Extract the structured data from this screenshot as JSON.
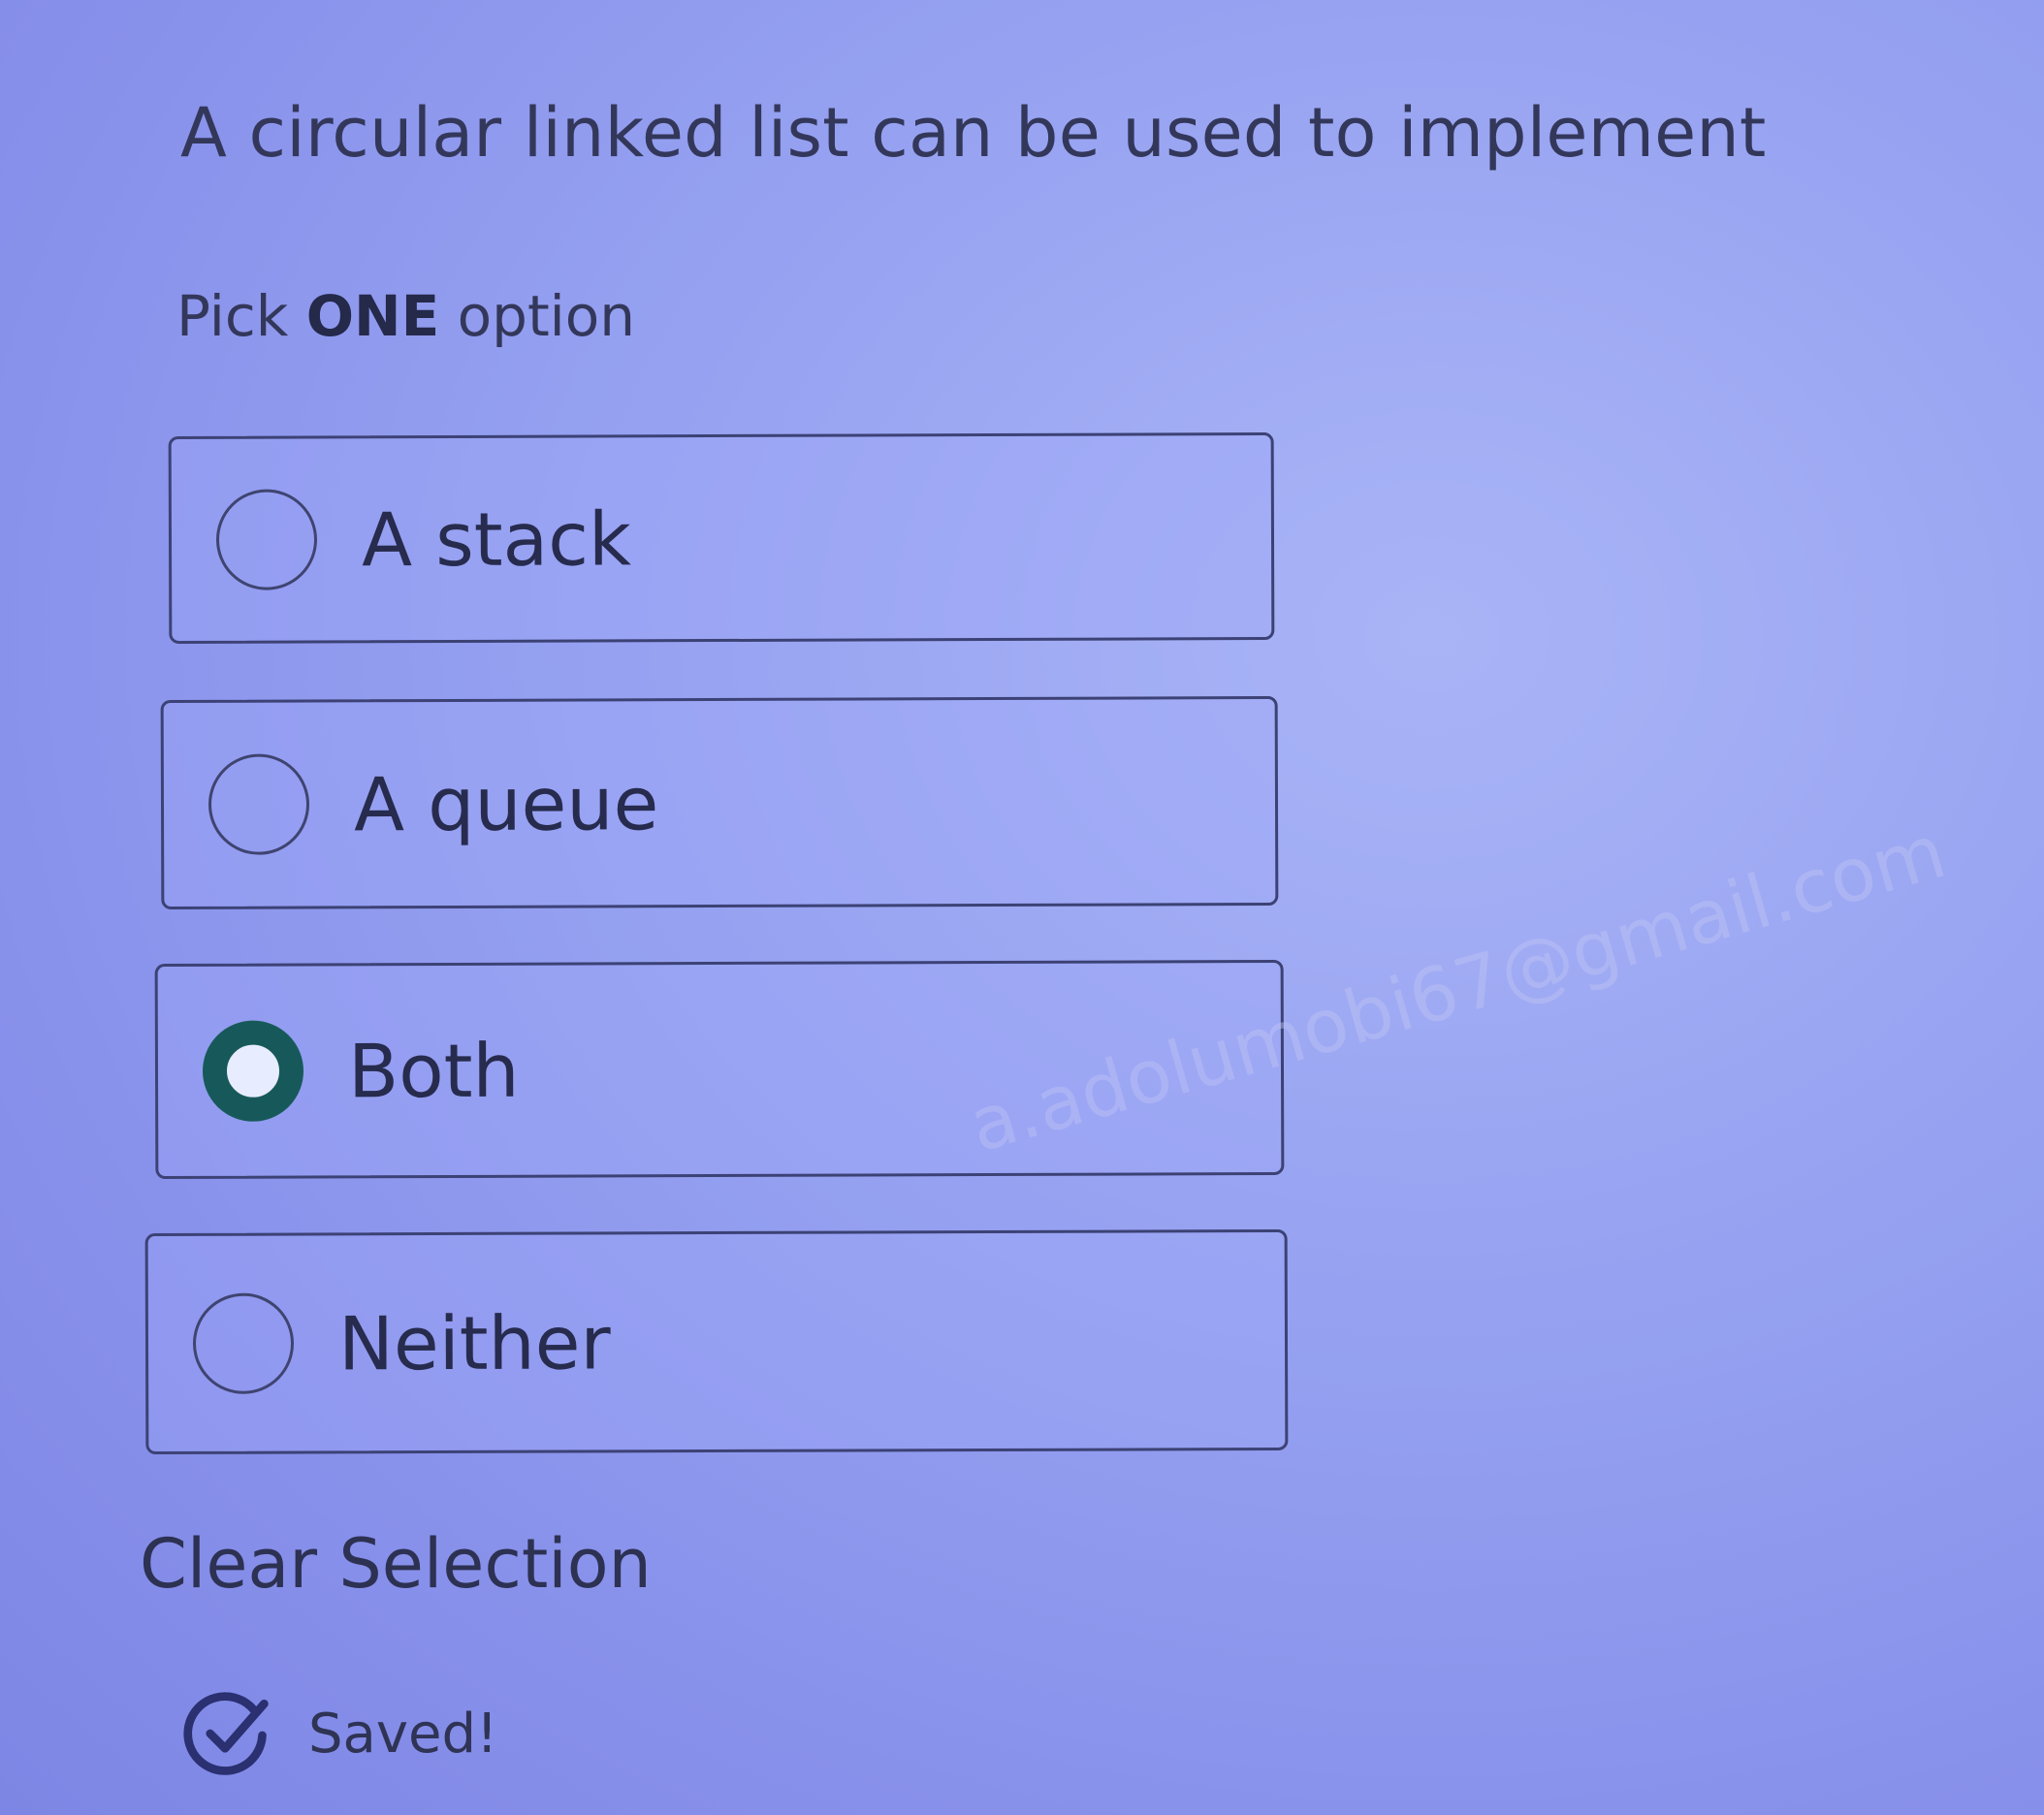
{
  "question": {
    "text": "A circular linked list can be used to implement"
  },
  "instruction": {
    "prefix": "Pick ",
    "emphasis": "ONE",
    "suffix": " option"
  },
  "options": [
    {
      "label": "A stack",
      "selected": false
    },
    {
      "label": "A queue",
      "selected": false
    },
    {
      "label": "Both",
      "selected": true
    },
    {
      "label": "Neither",
      "selected": false
    }
  ],
  "clear_selection": {
    "label": "Clear Selection"
  },
  "status": {
    "text": "Saved!",
    "icon": "check-circle-icon"
  },
  "watermark": {
    "text": "a.adolumobi67@gmail.com"
  },
  "colors": {
    "selected_radio": "#17595a",
    "border": "#3c4275",
    "text": "#272b4d"
  }
}
